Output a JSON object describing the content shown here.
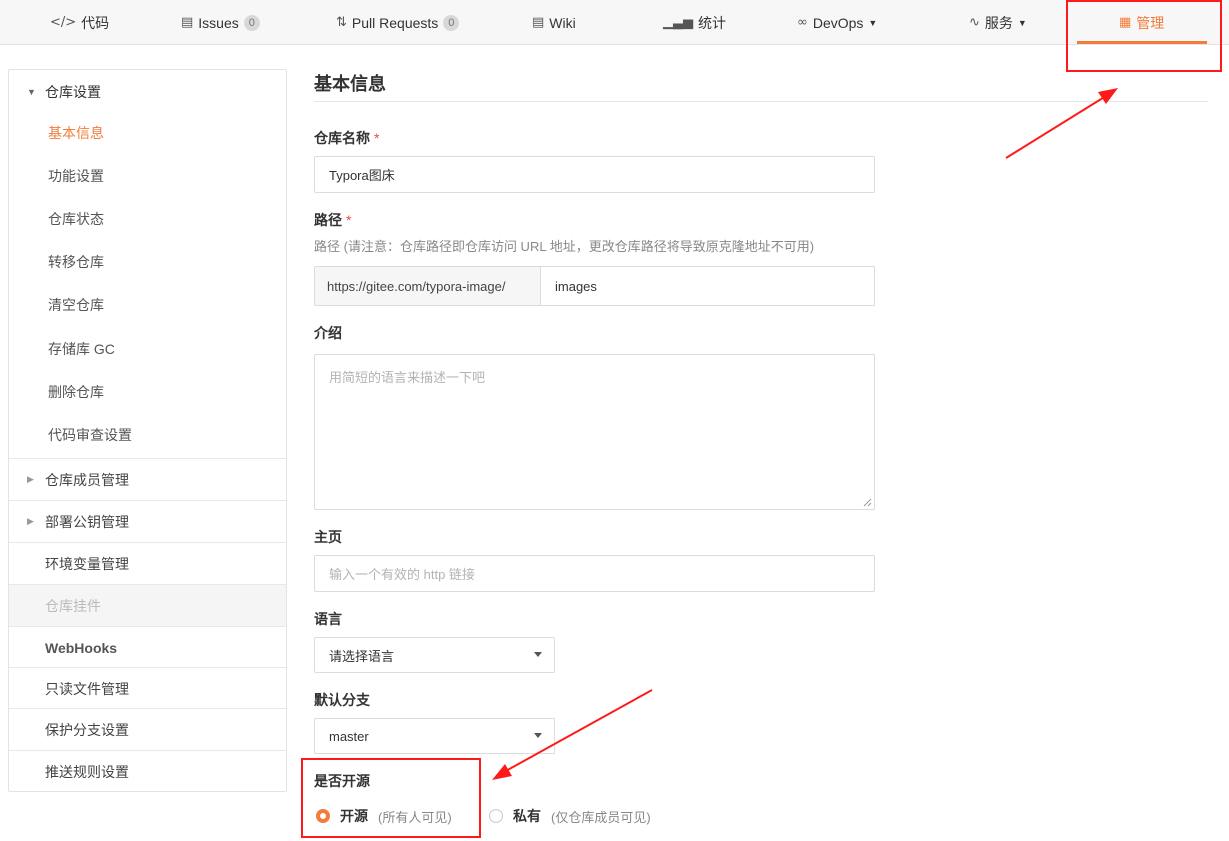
{
  "nav": {
    "tabs": [
      {
        "label": "代码",
        "icon": "code-icon"
      },
      {
        "label": "Issues",
        "icon": "issues-icon",
        "badge": "0"
      },
      {
        "label": "Pull Requests",
        "icon": "pull-request-icon",
        "badge": "0"
      },
      {
        "label": "Wiki",
        "icon": "wiki-icon"
      },
      {
        "label": "统计",
        "icon": "stats-icon"
      },
      {
        "label": "DevOps",
        "icon": "infinity-icon"
      },
      {
        "label": "服务",
        "icon": "pulse-icon"
      },
      {
        "label": "管理",
        "icon": "manage-icon",
        "active": true
      }
    ]
  },
  "sidebar": {
    "repo_settings": {
      "label": "仓库设置",
      "items": [
        "基本信息",
        "功能设置",
        "仓库状态",
        "转移仓库",
        "清空仓库",
        "存储库 GC",
        "删除仓库",
        "代码审查设置"
      ],
      "active_index": 0
    },
    "sections": [
      {
        "label": "仓库成员管理",
        "collapsible": true
      },
      {
        "label": "部署公钥管理",
        "collapsible": true
      },
      {
        "label": "环境变量管理"
      },
      {
        "label": "仓库挂件",
        "disabled": true
      },
      {
        "label": "WebHooks",
        "bold": true
      },
      {
        "label": "只读文件管理"
      },
      {
        "label": "保护分支设置"
      },
      {
        "label": "推送规则设置"
      }
    ]
  },
  "form": {
    "title": "基本信息",
    "repo_name": {
      "label": "仓库名称",
      "required": "*",
      "value": "Typora图床"
    },
    "path": {
      "label": "路径",
      "required": "*",
      "hint": "路径 (请注意：仓库路径即仓库访问 URL 地址，更改仓库路径将导致原克隆地址不可用)",
      "prefix": "https://gitee.com/typora-image/",
      "value": "images"
    },
    "intro": {
      "label": "介绍",
      "placeholder": "用简短的语言来描述一下吧"
    },
    "homepage": {
      "label": "主页",
      "placeholder": "输入一个有效的 http 链接"
    },
    "language": {
      "label": "语言",
      "value": "请选择语言"
    },
    "default_branch": {
      "label": "默认分支",
      "value": "master"
    },
    "visibility": {
      "label": "是否开源",
      "options": [
        {
          "label": "开源",
          "note": "(所有人可见)",
          "checked": true
        },
        {
          "label": "私有",
          "note": "(仅仓库成员可见)",
          "checked": false
        }
      ]
    }
  },
  "colors": {
    "accent": "#f27c3a",
    "annotation": "#ff1a1a"
  }
}
